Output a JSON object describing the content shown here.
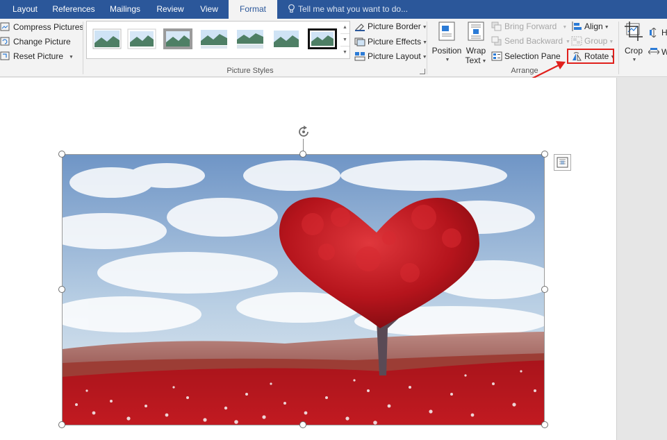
{
  "tabs": [
    {
      "label": "Layout"
    },
    {
      "label": "References"
    },
    {
      "label": "Mailings"
    },
    {
      "label": "Review"
    },
    {
      "label": "View"
    },
    {
      "label": "Format",
      "active": true
    }
  ],
  "tell_me": {
    "placeholder": "Tell me what you want to do..."
  },
  "adjust": {
    "compress": "Compress Pictures",
    "change": "Change Picture",
    "reset": "Reset Picture"
  },
  "picture_styles": {
    "label": "Picture Styles",
    "border": "Picture Border",
    "effects": "Picture Effects",
    "layout": "Picture Layout"
  },
  "arrange": {
    "label": "Arrange",
    "position": "Position",
    "wrap_line1": "Wrap",
    "wrap_line2": "Text",
    "bring_forward": "Bring Forward",
    "send_backward": "Send Backward",
    "selection_pane": "Selection Pane",
    "align": "Align",
    "group": "Group",
    "rotate": "Rotate"
  },
  "size": {
    "crop": "Crop",
    "height_fragment": "H",
    "width_fragment": "W"
  },
  "colors": {
    "accent": "#2b579a",
    "highlight": "#e0201c"
  },
  "icons": {
    "tell_me": "lightbulb-icon",
    "rotate_handle": "rotate-arrow-icon",
    "layout_options": "layout-options-icon"
  }
}
